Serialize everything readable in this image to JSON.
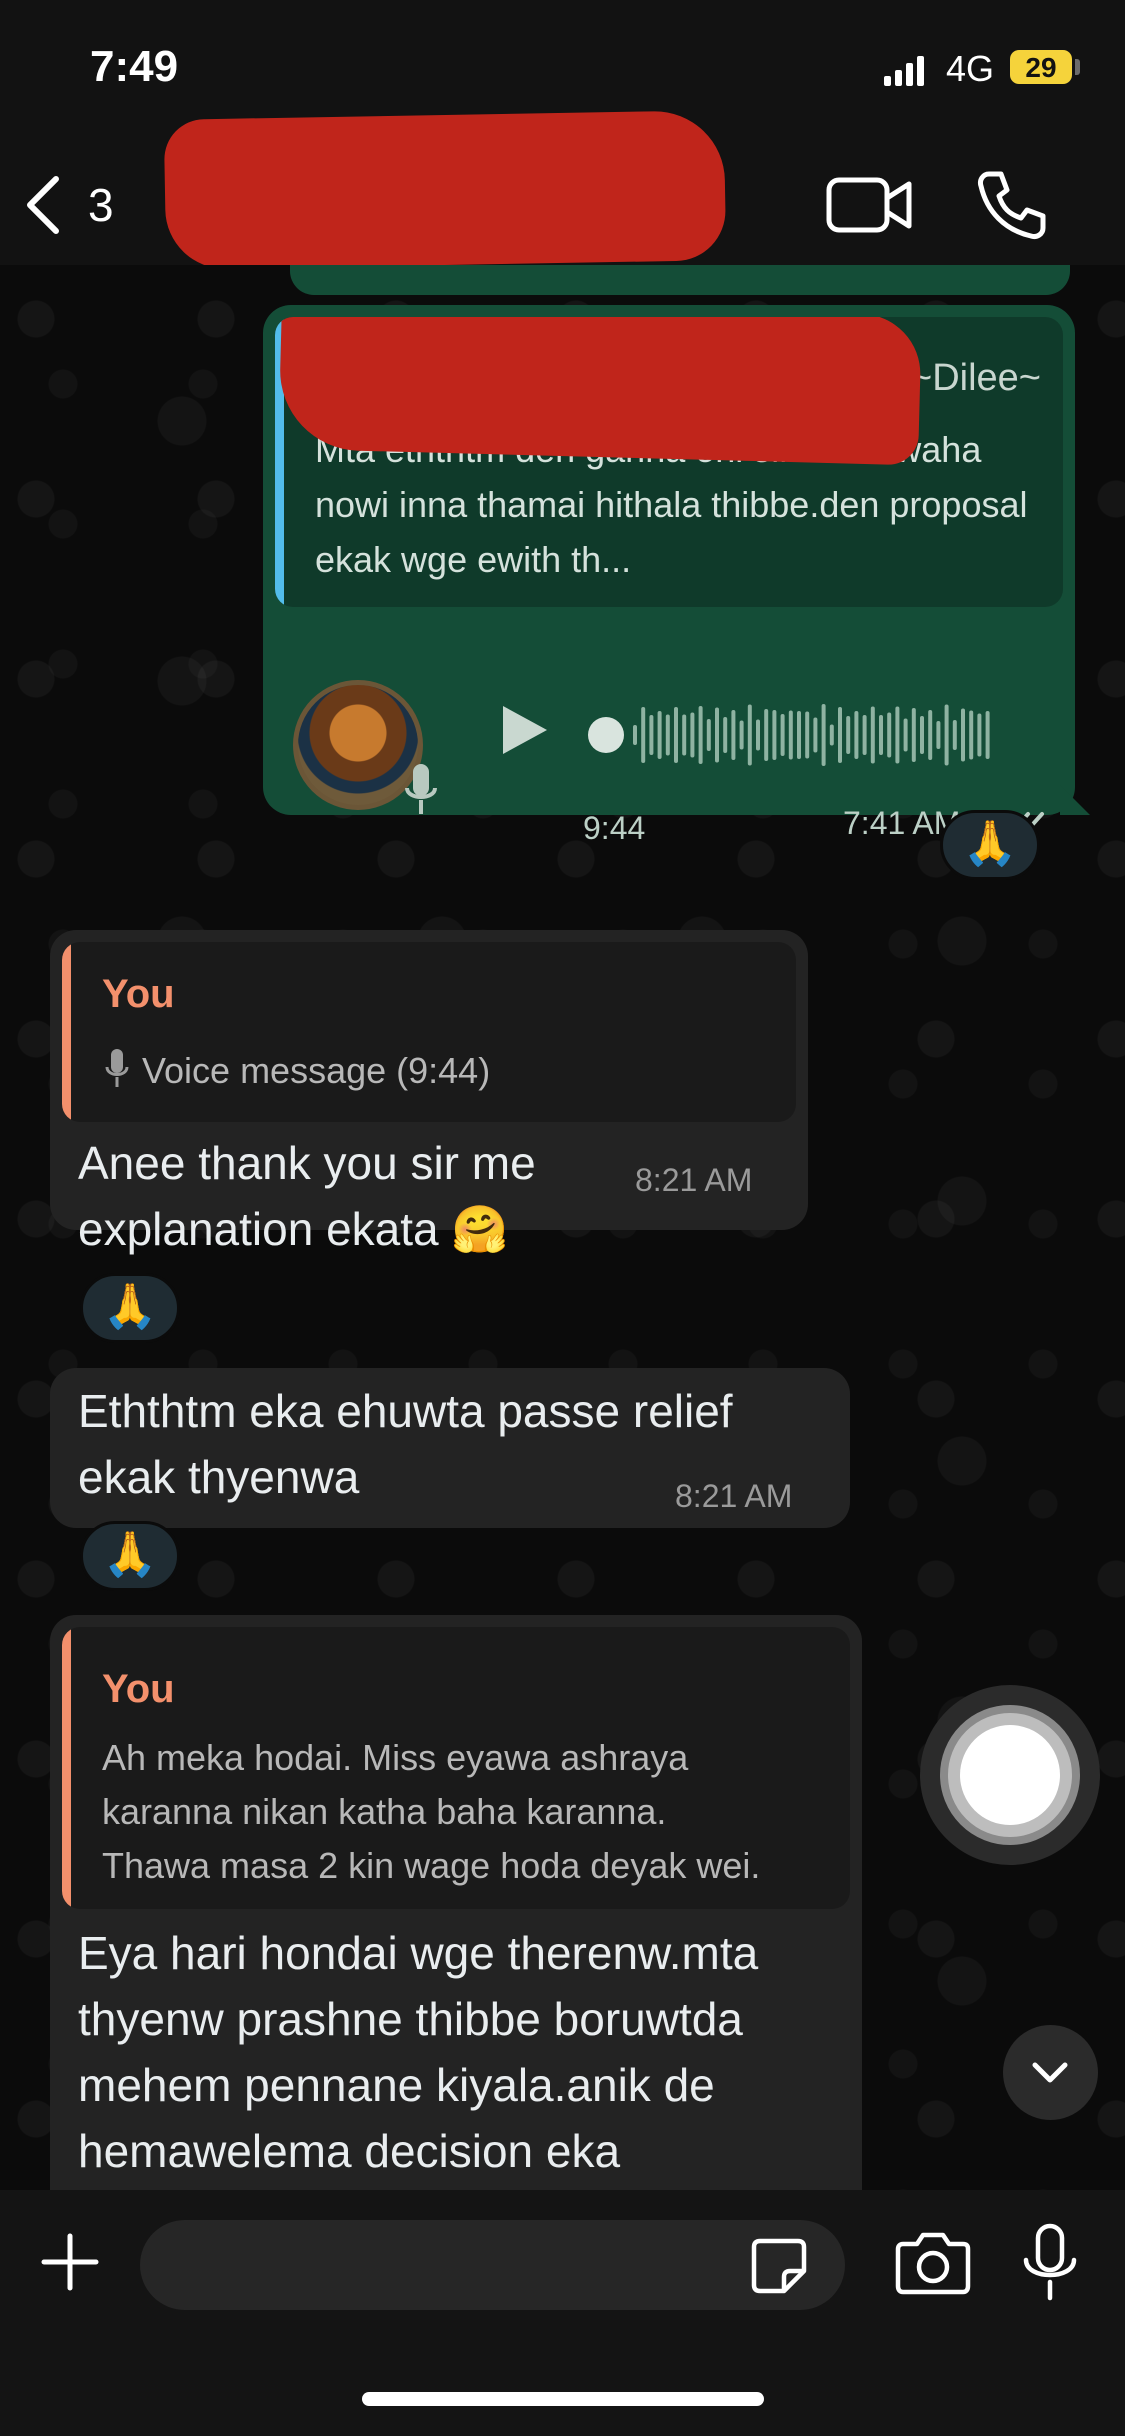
{
  "status_bar": {
    "time": "7:49",
    "network": "4G",
    "battery": "29"
  },
  "header": {
    "back_count": "3",
    "icons": {
      "back": "chevron-left-icon",
      "video": "video-camera-icon",
      "call": "phone-icon"
    }
  },
  "messages": {
    "voice_out": {
      "quote_author": "~Dilee~",
      "quote_text": "Mta eththtm den ganna oni sir mn wiwaha nowi inna thamai hithala thibbe.den proposal ekak wge ewith th...",
      "duration": "9:44",
      "time": "7:41 AM",
      "reaction": "🙏"
    },
    "msg1": {
      "quote_label": "You",
      "quote_text": "Voice message (9:44)",
      "text_line1": "Anee thank you sir me",
      "text_line2": "explanation ekata 🤗",
      "time": "8:21 AM",
      "reaction": "🙏"
    },
    "msg2": {
      "text_line1": "Eththtm eka ehuwta passe relief",
      "text_line2": "ekak thyenwa",
      "time": "8:21 AM",
      "reaction": "🙏"
    },
    "msg3": {
      "quote_label": "You",
      "quote_line1": "Ah meka hodai. Miss eyawa ashraya",
      "quote_line2": "karanna nikan katha baha karanna.",
      "quote_line3": "Thawa masa 2 kin wage hoda deyak wei.",
      "text_line1": "Eya hari hondai wge therenw.mta",
      "text_line2": "thyenw prashne thibbe boruwtda",
      "text_line3": "mehem pennane kiyala.anik de",
      "text_line4": "hemawelema decision eka"
    }
  },
  "input_bar": {
    "placeholder": "",
    "icons": {
      "plus": "plus-icon",
      "sticker": "sticker-icon",
      "camera": "camera-icon",
      "mic": "microphone-icon"
    }
  },
  "colors": {
    "outgoing_bubble": "#144d37",
    "incoming_bubble": "#232323",
    "you_label": "#f3906c",
    "quote_bar_out": "#53bdeb",
    "redaction": "#c0251b"
  }
}
